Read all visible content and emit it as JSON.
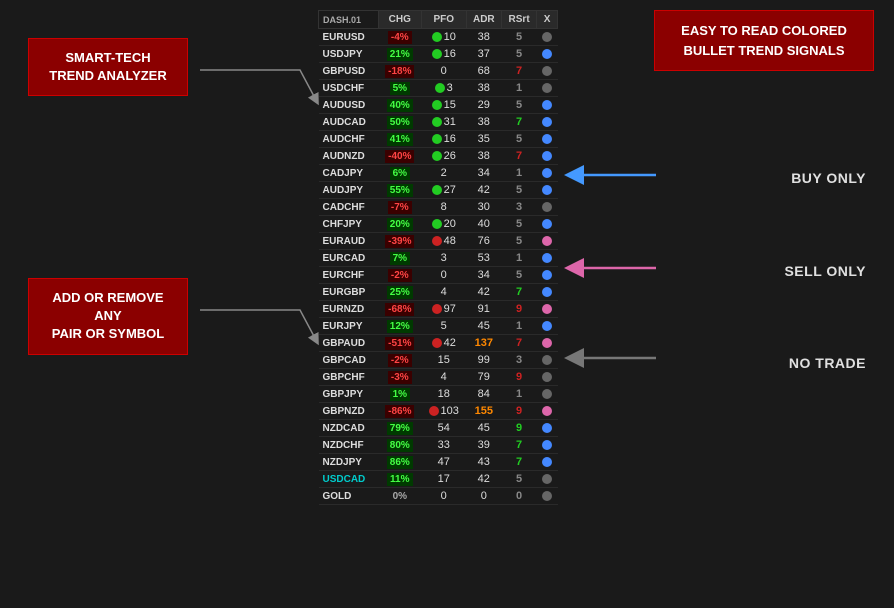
{
  "labels": {
    "smart_tech": "SMART-TECH\nTREND ANALYZER",
    "add_remove": "ADD OR REMOVE ANY\nPAIR OR SYMBOL",
    "easy_read": "EASY TO READ COLORED\nBULLET TREND SIGNALS",
    "buy_only": "BUY ONLY",
    "sell_only": "SELL ONLY",
    "no_trade": "NO TRADE"
  },
  "table": {
    "header": [
      "DASH.01",
      "CHG",
      "PFO",
      "ADR",
      "RSrt",
      "X"
    ],
    "rows": [
      {
        "sym": "EURUSD",
        "chg": "-4%",
        "chg_cls": "chg-neg",
        "pfo": "10",
        "adr": "38",
        "rstr": "5",
        "rstr_cls": "rstr-gray",
        "dot": "dot-gray",
        "has_pfo_dot": true,
        "pfo_dot": "dot-green"
      },
      {
        "sym": "USDJPY",
        "chg": "21%",
        "chg_cls": "chg-pos",
        "pfo": "16",
        "adr": "37",
        "rstr": "5",
        "rstr_cls": "rstr-gray",
        "dot": "dot-blue",
        "has_pfo_dot": true,
        "pfo_dot": "dot-green"
      },
      {
        "sym": "GBPUSD",
        "chg": "-18%",
        "chg_cls": "chg-neg",
        "pfo": "0",
        "adr": "68",
        "rstr": "7",
        "rstr_cls": "rstr-red",
        "dot": "dot-gray",
        "has_pfo_dot": false,
        "pfo_dot": ""
      },
      {
        "sym": "USDCHF",
        "chg": "5%",
        "chg_cls": "chg-pos",
        "pfo": "3",
        "adr": "38",
        "rstr": "1",
        "rstr_cls": "rstr-gray",
        "dot": "dot-gray",
        "has_pfo_dot": true,
        "pfo_dot": "dot-green"
      },
      {
        "sym": "AUDUSD",
        "chg": "40%",
        "chg_cls": "chg-pos",
        "pfo": "15",
        "adr": "29",
        "rstr": "5",
        "rstr_cls": "rstr-gray",
        "dot": "dot-blue",
        "has_pfo_dot": true,
        "pfo_dot": "dot-green"
      },
      {
        "sym": "AUDCAD",
        "chg": "50%",
        "chg_cls": "chg-pos",
        "pfo": "31",
        "adr": "38",
        "rstr": "7",
        "rstr_cls": "rstr-green",
        "dot": "dot-blue",
        "has_pfo_dot": true,
        "pfo_dot": "dot-green"
      },
      {
        "sym": "AUDCHF",
        "chg": "41%",
        "chg_cls": "chg-pos",
        "pfo": "16",
        "adr": "35",
        "rstr": "5",
        "rstr_cls": "rstr-gray",
        "dot": "dot-blue",
        "has_pfo_dot": true,
        "pfo_dot": "dot-green"
      },
      {
        "sym": "AUDNZD",
        "chg": "-40%",
        "chg_cls": "chg-neg",
        "pfo": "26",
        "adr": "38",
        "rstr": "7",
        "rstr_cls": "rstr-red",
        "dot": "dot-blue",
        "has_pfo_dot": true,
        "pfo_dot": "dot-green"
      },
      {
        "sym": "CADJPY",
        "chg": "6%",
        "chg_cls": "chg-pos",
        "pfo": "2",
        "adr": "34",
        "rstr": "1",
        "rstr_cls": "rstr-gray",
        "dot": "dot-blue",
        "has_pfo_dot": false,
        "pfo_dot": ""
      },
      {
        "sym": "AUDJPY",
        "chg": "55%",
        "chg_cls": "chg-pos",
        "pfo": "27",
        "adr": "42",
        "rstr": "5",
        "rstr_cls": "rstr-gray",
        "dot": "dot-blue",
        "has_pfo_dot": true,
        "pfo_dot": "dot-green"
      },
      {
        "sym": "CADCHF",
        "chg": "-7%",
        "chg_cls": "chg-neg",
        "pfo": "8",
        "adr": "30",
        "rstr": "3",
        "rstr_cls": "rstr-gray",
        "dot": "dot-gray",
        "has_pfo_dot": false,
        "pfo_dot": ""
      },
      {
        "sym": "CHFJPY",
        "chg": "20%",
        "chg_cls": "chg-pos",
        "pfo": "20",
        "adr": "40",
        "rstr": "5",
        "rstr_cls": "rstr-gray",
        "dot": "dot-blue",
        "has_pfo_dot": true,
        "pfo_dot": "dot-green"
      },
      {
        "sym": "EURAUD",
        "chg": "-39%",
        "chg_cls": "chg-neg",
        "pfo": "48",
        "adr": "76",
        "rstr": "5",
        "rstr_cls": "rstr-gray",
        "dot": "dot-pink",
        "has_pfo_dot": true,
        "pfo_dot": "dot-red"
      },
      {
        "sym": "EURCAD",
        "chg": "7%",
        "chg_cls": "chg-pos",
        "pfo": "3",
        "adr": "53",
        "rstr": "1",
        "rstr_cls": "rstr-gray",
        "dot": "dot-blue",
        "has_pfo_dot": false,
        "pfo_dot": ""
      },
      {
        "sym": "EURCHF",
        "chg": "-2%",
        "chg_cls": "chg-neg",
        "pfo": "0",
        "adr": "34",
        "rstr": "5",
        "rstr_cls": "rstr-gray",
        "dot": "dot-blue",
        "has_pfo_dot": false,
        "pfo_dot": ""
      },
      {
        "sym": "EURGBP",
        "chg": "25%",
        "chg_cls": "chg-pos",
        "pfo": "4",
        "adr": "42",
        "rstr": "7",
        "rstr_cls": "rstr-green",
        "dot": "dot-blue",
        "has_pfo_dot": false,
        "pfo_dot": ""
      },
      {
        "sym": "EURNZD",
        "chg": "-68%",
        "chg_cls": "chg-neg",
        "pfo": "97",
        "adr": "91",
        "rstr": "9",
        "rstr_cls": "rstr-red",
        "dot": "dot-pink",
        "has_pfo_dot": true,
        "pfo_dot": "dot-red"
      },
      {
        "sym": "EURJPY",
        "chg": "12%",
        "chg_cls": "chg-pos",
        "pfo": "5",
        "adr": "45",
        "rstr": "1",
        "rstr_cls": "rstr-gray",
        "dot": "dot-blue",
        "has_pfo_dot": false,
        "pfo_dot": ""
      },
      {
        "sym": "GBPAUD",
        "chg": "-51%",
        "chg_cls": "chg-neg",
        "pfo": "42",
        "adr": "137",
        "rstr": "7",
        "rstr_cls": "rstr-red",
        "dot": "dot-pink",
        "has_pfo_dot": true,
        "pfo_dot": "dot-red",
        "adr_hi": true
      },
      {
        "sym": "GBPCAD",
        "chg": "-2%",
        "chg_cls": "chg-neg",
        "pfo": "15",
        "adr": "99",
        "rstr": "3",
        "rstr_cls": "rstr-gray",
        "dot": "dot-gray",
        "has_pfo_dot": false,
        "pfo_dot": ""
      },
      {
        "sym": "GBPCHF",
        "chg": "-3%",
        "chg_cls": "chg-neg",
        "pfo": "4",
        "adr": "79",
        "rstr": "9",
        "rstr_cls": "rstr-red",
        "dot": "dot-gray",
        "has_pfo_dot": false,
        "pfo_dot": ""
      },
      {
        "sym": "GBPJPY",
        "chg": "1%",
        "chg_cls": "chg-pos",
        "pfo": "18",
        "adr": "84",
        "rstr": "1",
        "rstr_cls": "rstr-gray",
        "dot": "dot-gray",
        "has_pfo_dot": false,
        "pfo_dot": ""
      },
      {
        "sym": "GBPNZD",
        "chg": "-86%",
        "chg_cls": "chg-neg",
        "pfo": "103",
        "adr": "155",
        "rstr": "9",
        "rstr_cls": "rstr-red",
        "dot": "dot-pink",
        "has_pfo_dot": true,
        "pfo_dot": "dot-red",
        "adr_hi": true
      },
      {
        "sym": "NZDCAD",
        "chg": "79%",
        "chg_cls": "chg-pos",
        "pfo": "54",
        "adr": "45",
        "rstr": "9",
        "rstr_cls": "rstr-green",
        "dot": "dot-blue",
        "has_pfo_dot": false,
        "pfo_dot": ""
      },
      {
        "sym": "NZDCHF",
        "chg": "80%",
        "chg_cls": "chg-pos",
        "pfo": "33",
        "adr": "39",
        "rstr": "7",
        "rstr_cls": "rstr-green",
        "dot": "dot-blue",
        "has_pfo_dot": false,
        "pfo_dot": ""
      },
      {
        "sym": "NZDJPY",
        "chg": "86%",
        "chg_cls": "chg-pos",
        "pfo": "47",
        "adr": "43",
        "rstr": "7",
        "rstr_cls": "rstr-green",
        "dot": "dot-blue",
        "has_pfo_dot": false,
        "pfo_dot": ""
      },
      {
        "sym": "USDCAD",
        "chg": "11%",
        "chg_cls": "chg-pos sym-cyan",
        "pfo": "17",
        "adr": "42",
        "rstr": "5",
        "rstr_cls": "rstr-gray",
        "dot": "dot-gray",
        "has_pfo_dot": false,
        "pfo_dot": "",
        "sym_cls": "sym-cyan"
      },
      {
        "sym": "GOLD",
        "chg": "0%",
        "chg_cls": "chg-neu",
        "pfo": "0",
        "adr": "0",
        "rstr": "0",
        "rstr_cls": "rstr-gray",
        "dot": "dot-gray",
        "has_pfo_dot": false,
        "pfo_dot": ""
      }
    ]
  }
}
